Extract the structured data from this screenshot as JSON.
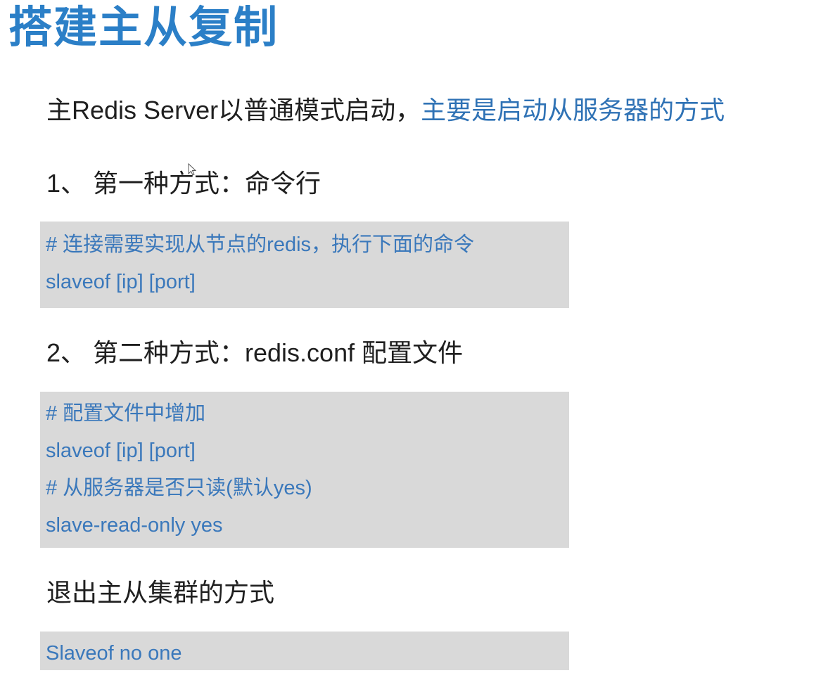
{
  "title": "搭建主从复制",
  "lead": {
    "text": "主Redis Server以普通模式启动，",
    "accent": "主要是启动从服务器的方式"
  },
  "section1": {
    "heading": "1、 第一种方式：命令行",
    "code": [
      "# 连接需要实现从节点的redis，执行下面的命令",
      "slaveof  [ip]  [port]"
    ]
  },
  "section2": {
    "heading": "2、 第二种方式：redis.conf 配置文件",
    "code": [
      "# 配置文件中增加",
      "slaveof  [ip]  [port]",
      "# 从服务器是否只读(默认yes)",
      "slave-read-only yes"
    ]
  },
  "section3": {
    "heading": "退出主从集群的方式",
    "code": [
      "Slaveof no one"
    ]
  },
  "colors": {
    "title": "#2b7fc7",
    "accent": "#2f72b5",
    "code_text": "#3a78bb",
    "code_bg": "#d9d9d9"
  },
  "icons": {
    "cursor": "mouse-pointer-icon"
  }
}
